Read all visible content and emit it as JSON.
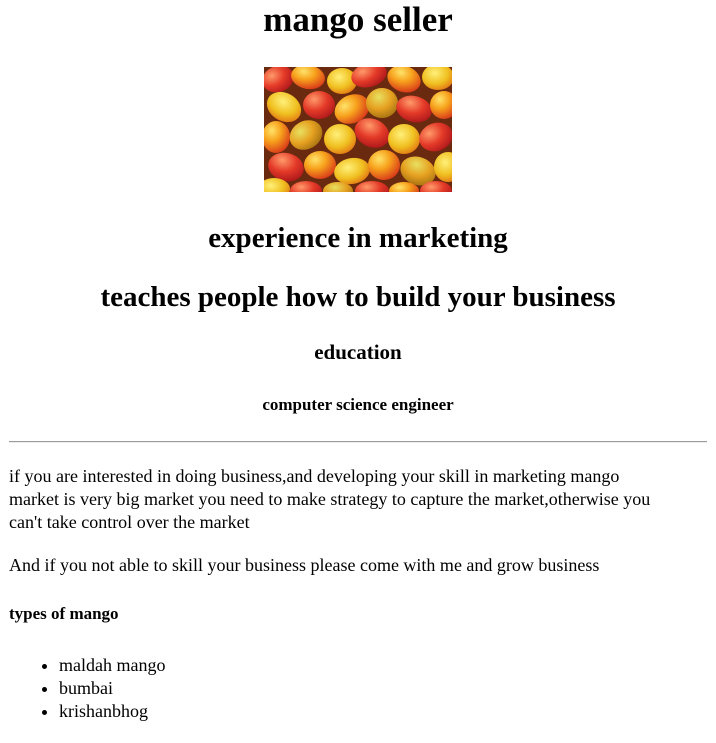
{
  "page": {
    "title": "mango seller",
    "image_alt": "mangoes"
  },
  "headings": {
    "experience": "experience in marketing",
    "teaches": "teaches people how to build your business",
    "education": "education",
    "degree": "computer science engineer"
  },
  "paragraphs": {
    "intro": "if you are interested in doing business,and developing your skill in marketing mango market is very big market you need to make strategy to capture the market,otherwise you can't take control over the market",
    "invite": "And if you not able to skill your business please come with me and grow business"
  },
  "types": {
    "heading": "types of mango",
    "items": [
      "maldah mango",
      "bumbai",
      "krishanbhog"
    ]
  },
  "colors": {
    "text": "#000000",
    "background": "#ffffff",
    "divider": "#9a9a9a"
  }
}
